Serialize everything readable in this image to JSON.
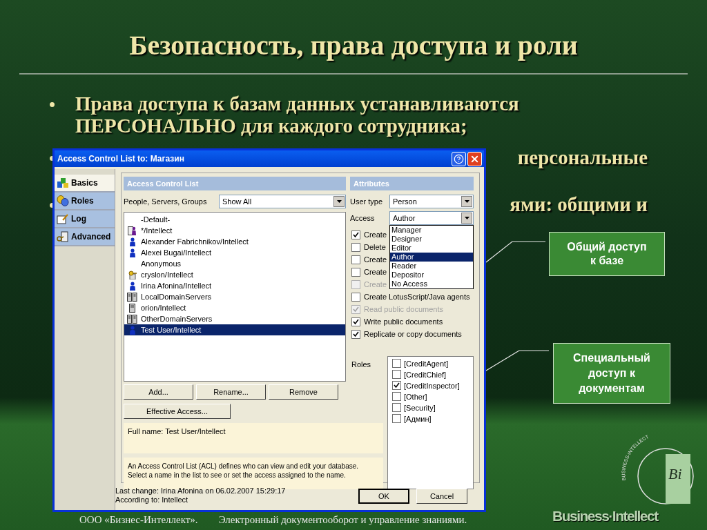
{
  "slide": {
    "title": "Безопасность, права доступа и роли",
    "bullets": [
      {
        "text": "Права доступа к базам данных устанавливаются ПЕРСОНАЛЬНО для каждого сотрудника;"
      },
      {
        "text": "персональные"
      },
      {
        "text": "ями: общими и"
      }
    ],
    "callouts": [
      {
        "text": "Общий доступ к базе"
      },
      {
        "text": "Специальный доступ к документам"
      }
    ],
    "footer": {
      "company": "ООО «Бизнес-Интеллект».",
      "tagline": "Электронный документооборот и управление знаниями."
    },
    "logo": {
      "ring_text": "BUSINESS-INTELLECT",
      "monogram": "Bi",
      "wordmark": "Business·Intellect"
    }
  },
  "dialog": {
    "title": "Access Control List to: Магазин",
    "tabs": [
      {
        "label": "Basics",
        "selected": true
      },
      {
        "label": "Roles",
        "selected": false
      },
      {
        "label": "Log",
        "selected": false
      },
      {
        "label": "Advanced",
        "selected": false
      }
    ],
    "acl": {
      "header": "Access Control List",
      "filter_label": "People, Servers, Groups",
      "filter_value": "Show All",
      "entries": [
        {
          "name": "-Default-",
          "kind": "blank",
          "selected": false
        },
        {
          "name": "*/Intellect",
          "kind": "group",
          "selected": false
        },
        {
          "name": "Alexander Fabrichnikov/Intellect",
          "kind": "person",
          "selected": false
        },
        {
          "name": "Alexei Bugai/Intellect",
          "kind": "person",
          "selected": false
        },
        {
          "name": "Anonymous",
          "kind": "blank",
          "selected": false
        },
        {
          "name": "cryslon/Intellect",
          "kind": "key-server",
          "selected": false
        },
        {
          "name": "Irina Afonina/Intellect",
          "kind": "person",
          "selected": false
        },
        {
          "name": "LocalDomainServers",
          "kind": "server-group",
          "selected": false
        },
        {
          "name": "orion/Intellect",
          "kind": "server",
          "selected": false
        },
        {
          "name": "OtherDomainServers",
          "kind": "server-group",
          "selected": false
        },
        {
          "name": "Test User/Intellect",
          "kind": "person",
          "selected": true
        }
      ],
      "buttons": [
        "Add...",
        "Rename...",
        "Remove"
      ],
      "effective_button": "Effective Access...",
      "full_name": "Full name: Test User/Intellect",
      "description": "An Access Control List (ACL) defines who can view and edit your database. Select a name in the list to see or set the access assigned to the name."
    },
    "attributes": {
      "header": "Attributes",
      "user_type": {
        "label": "User type",
        "value": "Person"
      },
      "access": {
        "label": "Access",
        "value": "Author",
        "expanded": true,
        "options": [
          {
            "label": "Manager",
            "selected": false
          },
          {
            "label": "Designer",
            "selected": false
          },
          {
            "label": "Editor",
            "selected": false
          },
          {
            "label": "Author",
            "selected": true
          },
          {
            "label": "Reader",
            "selected": false
          },
          {
            "label": "Depositor",
            "selected": false
          },
          {
            "label": "No Access",
            "selected": false
          }
        ]
      },
      "permissions": [
        {
          "label": "Create",
          "checked": true,
          "disabled": false
        },
        {
          "label": "Delete",
          "checked": false,
          "disabled": false
        },
        {
          "label": "Create",
          "checked": false,
          "disabled": false
        },
        {
          "label": "Create",
          "checked": false,
          "disabled": false
        },
        {
          "label": "Create",
          "checked": false,
          "disabled": true
        },
        {
          "label": "Create LotusScript/Java agents",
          "checked": false,
          "disabled": false
        },
        {
          "label": "Read public documents",
          "checked": true,
          "disabled": true
        },
        {
          "label": "Write public documents",
          "checked": true,
          "disabled": false
        },
        {
          "label": "Replicate or copy documents",
          "checked": true,
          "disabled": false
        }
      ],
      "roles": {
        "label": "Roles",
        "items": [
          {
            "label": "[CreditAgent]",
            "checked": false
          },
          {
            "label": "[CreditChief]",
            "checked": false
          },
          {
            "label": "[CreditInspector]",
            "checked": true
          },
          {
            "label": "[Other]",
            "checked": false
          },
          {
            "label": "[Security]",
            "checked": false
          },
          {
            "label": "[Админ]",
            "checked": false
          }
        ]
      }
    },
    "status": {
      "last_change": "Last change: Irina Afonina on 06.02.2007 15:29:17",
      "according_to": "According to: Intellect",
      "buttons": [
        {
          "label": "OK",
          "default": true
        },
        {
          "label": "Cancel",
          "default": false
        }
      ]
    }
  }
}
